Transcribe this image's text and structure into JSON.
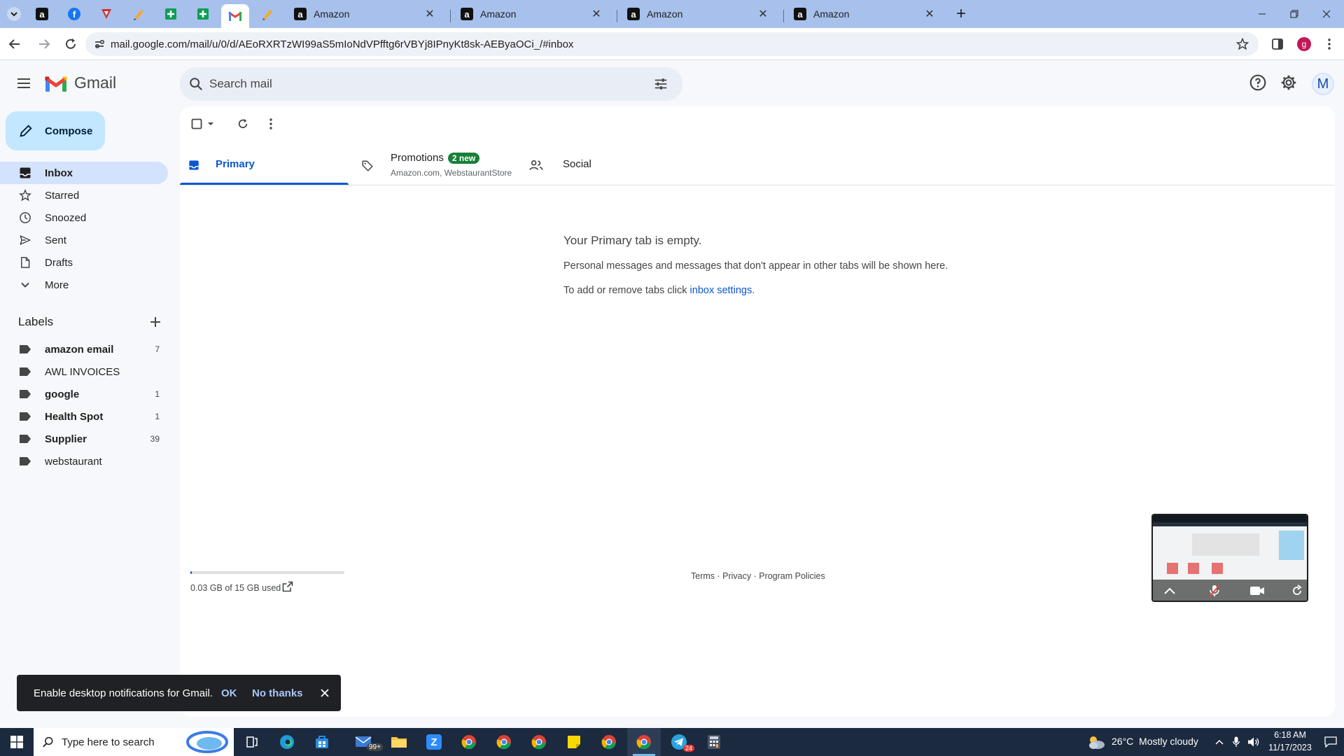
{
  "browser": {
    "tabs": [
      {
        "title": "Amazon"
      },
      {
        "title": "Amazon"
      },
      {
        "title": "Amazon"
      },
      {
        "title": "Amazon"
      }
    ],
    "url": "mail.google.com/mail/u/0/d/AEoRXRTzWI99aS5mIoNdVPfftg6rVBYj8IPnyKt8sk-AEByaOCi_/#inbox",
    "profile_initial": "g",
    "close_glyph": "✕",
    "new_tab_glyph": "+",
    "colors": {
      "tabstrip": "#a7c1ec",
      "accent": "#0b57d0",
      "profile": "#c2185b"
    }
  },
  "gmail": {
    "brand": "Gmail",
    "search_placeholder": "Search mail",
    "compose_label": "Compose",
    "avatar_initial": "M",
    "nav": [
      {
        "label": "Inbox",
        "icon": "inbox-icon",
        "active": true
      },
      {
        "label": "Starred",
        "icon": "star-icon"
      },
      {
        "label": "Snoozed",
        "icon": "clock-icon"
      },
      {
        "label": "Sent",
        "icon": "send-icon"
      },
      {
        "label": "Drafts",
        "icon": "draft-icon"
      },
      {
        "label": "More",
        "icon": "chevron-down-icon"
      }
    ],
    "labels_title": "Labels",
    "labels": [
      {
        "name": "amazon email",
        "count": "7",
        "bold": true
      },
      {
        "name": "AWL INVOICES",
        "count": "",
        "bold": false
      },
      {
        "name": "google",
        "count": "1",
        "bold": true
      },
      {
        "name": "Health Spot",
        "count": "1",
        "bold": true
      },
      {
        "name": "Supplier",
        "count": "39",
        "bold": true
      },
      {
        "name": "webstaurant",
        "count": "",
        "bold": false
      }
    ],
    "tabs": {
      "primary": "Primary",
      "promotions": "Promotions",
      "promotions_badge": "2 new",
      "promotions_sub": "Amazon.com, WebstaurantStore",
      "social": "Social"
    },
    "empty": {
      "title": "Your Primary tab is empty.",
      "line1": "Personal messages and messages that don't appear in other tabs will be shown here.",
      "line2_prefix": "To add or remove tabs click ",
      "line2_link": "inbox settings",
      "line2_suffix": "."
    },
    "storage": {
      "text": "0.03 GB of 15 GB used",
      "fraction": 0.002
    },
    "footer": {
      "terms": "Terms",
      "privacy": "Privacy",
      "policies": "Program Policies",
      "sep": " · "
    },
    "snackbar": {
      "message": "Enable desktop notifications for Gmail.",
      "ok": "OK",
      "no_thanks": "No thanks"
    }
  },
  "taskbar": {
    "search_placeholder": "Type here to search",
    "mail_badge": "99+",
    "telegram_badge": "24",
    "weather": "26°C  Mostly cloudy",
    "time": "6:18 AM",
    "date": "11/17/2023"
  }
}
